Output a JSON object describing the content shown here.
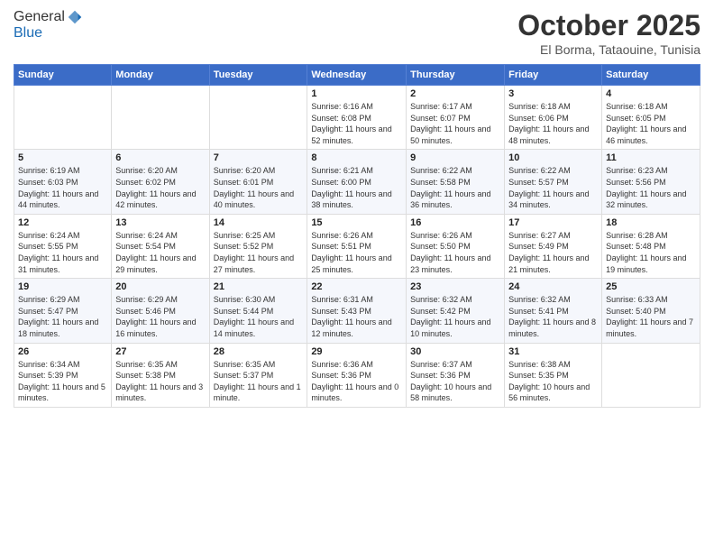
{
  "logo": {
    "general": "General",
    "blue": "Blue"
  },
  "header": {
    "month": "October 2025",
    "location": "El Borma, Tataouine, Tunisia"
  },
  "days_of_week": [
    "Sunday",
    "Monday",
    "Tuesday",
    "Wednesday",
    "Thursday",
    "Friday",
    "Saturday"
  ],
  "weeks": [
    [
      {
        "day": "",
        "sunrise": "",
        "sunset": "",
        "daylight": ""
      },
      {
        "day": "",
        "sunrise": "",
        "sunset": "",
        "daylight": ""
      },
      {
        "day": "",
        "sunrise": "",
        "sunset": "",
        "daylight": ""
      },
      {
        "day": "1",
        "sunrise": "Sunrise: 6:16 AM",
        "sunset": "Sunset: 6:08 PM",
        "daylight": "Daylight: 11 hours and 52 minutes."
      },
      {
        "day": "2",
        "sunrise": "Sunrise: 6:17 AM",
        "sunset": "Sunset: 6:07 PM",
        "daylight": "Daylight: 11 hours and 50 minutes."
      },
      {
        "day": "3",
        "sunrise": "Sunrise: 6:18 AM",
        "sunset": "Sunset: 6:06 PM",
        "daylight": "Daylight: 11 hours and 48 minutes."
      },
      {
        "day": "4",
        "sunrise": "Sunrise: 6:18 AM",
        "sunset": "Sunset: 6:05 PM",
        "daylight": "Daylight: 11 hours and 46 minutes."
      }
    ],
    [
      {
        "day": "5",
        "sunrise": "Sunrise: 6:19 AM",
        "sunset": "Sunset: 6:03 PM",
        "daylight": "Daylight: 11 hours and 44 minutes."
      },
      {
        "day": "6",
        "sunrise": "Sunrise: 6:20 AM",
        "sunset": "Sunset: 6:02 PM",
        "daylight": "Daylight: 11 hours and 42 minutes."
      },
      {
        "day": "7",
        "sunrise": "Sunrise: 6:20 AM",
        "sunset": "Sunset: 6:01 PM",
        "daylight": "Daylight: 11 hours and 40 minutes."
      },
      {
        "day": "8",
        "sunrise": "Sunrise: 6:21 AM",
        "sunset": "Sunset: 6:00 PM",
        "daylight": "Daylight: 11 hours and 38 minutes."
      },
      {
        "day": "9",
        "sunrise": "Sunrise: 6:22 AM",
        "sunset": "Sunset: 5:58 PM",
        "daylight": "Daylight: 11 hours and 36 minutes."
      },
      {
        "day": "10",
        "sunrise": "Sunrise: 6:22 AM",
        "sunset": "Sunset: 5:57 PM",
        "daylight": "Daylight: 11 hours and 34 minutes."
      },
      {
        "day": "11",
        "sunrise": "Sunrise: 6:23 AM",
        "sunset": "Sunset: 5:56 PM",
        "daylight": "Daylight: 11 hours and 32 minutes."
      }
    ],
    [
      {
        "day": "12",
        "sunrise": "Sunrise: 6:24 AM",
        "sunset": "Sunset: 5:55 PM",
        "daylight": "Daylight: 11 hours and 31 minutes."
      },
      {
        "day": "13",
        "sunrise": "Sunrise: 6:24 AM",
        "sunset": "Sunset: 5:54 PM",
        "daylight": "Daylight: 11 hours and 29 minutes."
      },
      {
        "day": "14",
        "sunrise": "Sunrise: 6:25 AM",
        "sunset": "Sunset: 5:52 PM",
        "daylight": "Daylight: 11 hours and 27 minutes."
      },
      {
        "day": "15",
        "sunrise": "Sunrise: 6:26 AM",
        "sunset": "Sunset: 5:51 PM",
        "daylight": "Daylight: 11 hours and 25 minutes."
      },
      {
        "day": "16",
        "sunrise": "Sunrise: 6:26 AM",
        "sunset": "Sunset: 5:50 PM",
        "daylight": "Daylight: 11 hours and 23 minutes."
      },
      {
        "day": "17",
        "sunrise": "Sunrise: 6:27 AM",
        "sunset": "Sunset: 5:49 PM",
        "daylight": "Daylight: 11 hours and 21 minutes."
      },
      {
        "day": "18",
        "sunrise": "Sunrise: 6:28 AM",
        "sunset": "Sunset: 5:48 PM",
        "daylight": "Daylight: 11 hours and 19 minutes."
      }
    ],
    [
      {
        "day": "19",
        "sunrise": "Sunrise: 6:29 AM",
        "sunset": "Sunset: 5:47 PM",
        "daylight": "Daylight: 11 hours and 18 minutes."
      },
      {
        "day": "20",
        "sunrise": "Sunrise: 6:29 AM",
        "sunset": "Sunset: 5:46 PM",
        "daylight": "Daylight: 11 hours and 16 minutes."
      },
      {
        "day": "21",
        "sunrise": "Sunrise: 6:30 AM",
        "sunset": "Sunset: 5:44 PM",
        "daylight": "Daylight: 11 hours and 14 minutes."
      },
      {
        "day": "22",
        "sunrise": "Sunrise: 6:31 AM",
        "sunset": "Sunset: 5:43 PM",
        "daylight": "Daylight: 11 hours and 12 minutes."
      },
      {
        "day": "23",
        "sunrise": "Sunrise: 6:32 AM",
        "sunset": "Sunset: 5:42 PM",
        "daylight": "Daylight: 11 hours and 10 minutes."
      },
      {
        "day": "24",
        "sunrise": "Sunrise: 6:32 AM",
        "sunset": "Sunset: 5:41 PM",
        "daylight": "Daylight: 11 hours and 8 minutes."
      },
      {
        "day": "25",
        "sunrise": "Sunrise: 6:33 AM",
        "sunset": "Sunset: 5:40 PM",
        "daylight": "Daylight: 11 hours and 7 minutes."
      }
    ],
    [
      {
        "day": "26",
        "sunrise": "Sunrise: 6:34 AM",
        "sunset": "Sunset: 5:39 PM",
        "daylight": "Daylight: 11 hours and 5 minutes."
      },
      {
        "day": "27",
        "sunrise": "Sunrise: 6:35 AM",
        "sunset": "Sunset: 5:38 PM",
        "daylight": "Daylight: 11 hours and 3 minutes."
      },
      {
        "day": "28",
        "sunrise": "Sunrise: 6:35 AM",
        "sunset": "Sunset: 5:37 PM",
        "daylight": "Daylight: 11 hours and 1 minute."
      },
      {
        "day": "29",
        "sunrise": "Sunrise: 6:36 AM",
        "sunset": "Sunset: 5:36 PM",
        "daylight": "Daylight: 11 hours and 0 minutes."
      },
      {
        "day": "30",
        "sunrise": "Sunrise: 6:37 AM",
        "sunset": "Sunset: 5:36 PM",
        "daylight": "Daylight: 10 hours and 58 minutes."
      },
      {
        "day": "31",
        "sunrise": "Sunrise: 6:38 AM",
        "sunset": "Sunset: 5:35 PM",
        "daylight": "Daylight: 10 hours and 56 minutes."
      },
      {
        "day": "",
        "sunrise": "",
        "sunset": "",
        "daylight": ""
      }
    ]
  ]
}
